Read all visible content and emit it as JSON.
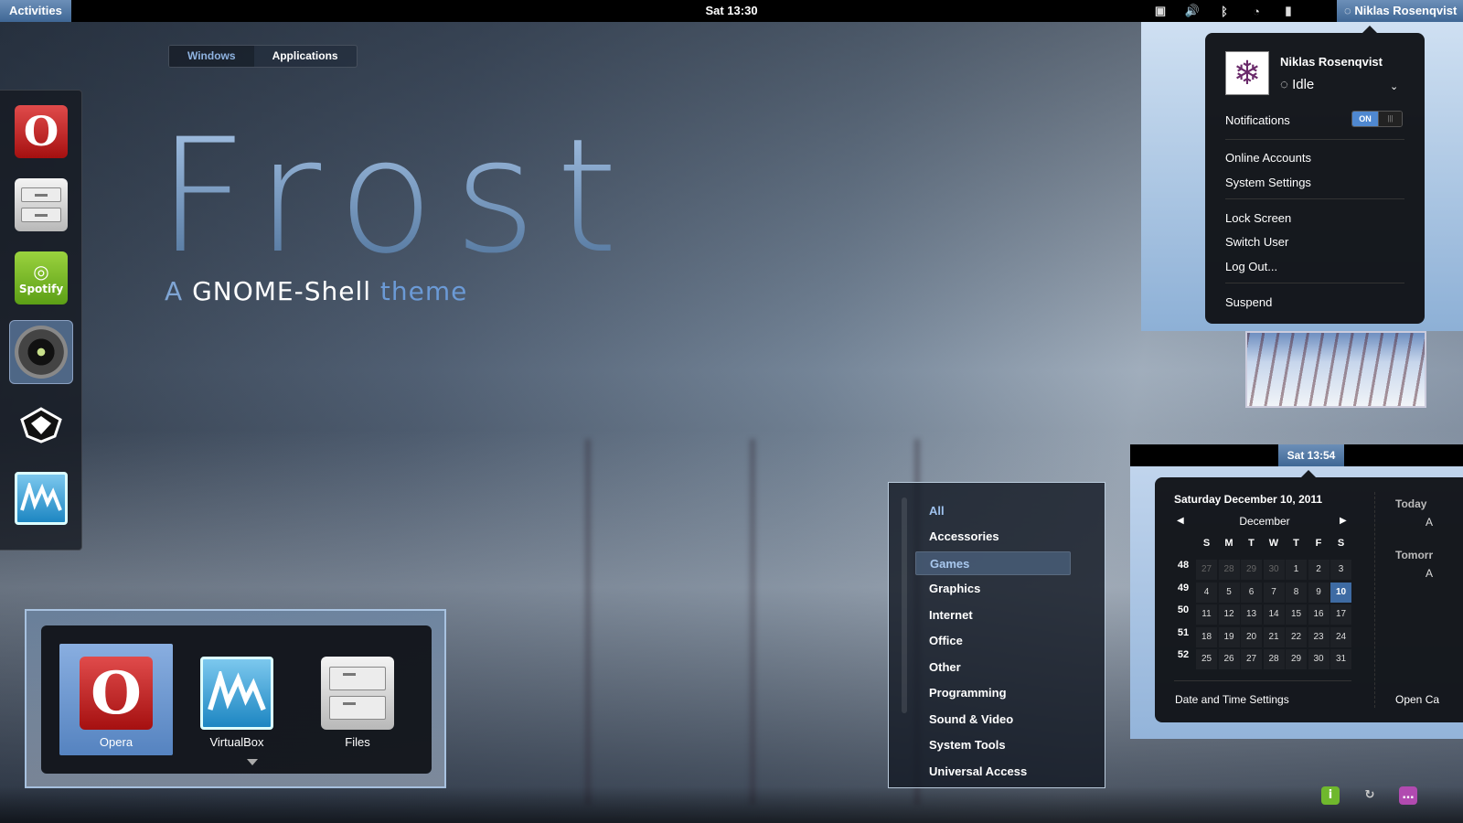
{
  "topbar": {
    "activities": "Activities",
    "clock": "Sat 13:30",
    "user_name": "Niklas Rosenqvist",
    "tray_icons": [
      "display-icon",
      "volume-icon",
      "bluetooth-icon",
      "wifi-icon",
      "battery-icon"
    ]
  },
  "view_selector": {
    "windows": "Windows",
    "applications": "Applications"
  },
  "dash": {
    "items": [
      {
        "name": "opera-icon",
        "selected": false
      },
      {
        "name": "files-icon",
        "selected": false
      },
      {
        "name": "spotify-icon",
        "label": "Spotify",
        "selected": false
      },
      {
        "name": "camera-icon",
        "selected": true
      },
      {
        "name": "inkscape-icon",
        "selected": false
      },
      {
        "name": "virtualbox-icon",
        "selected": false
      }
    ]
  },
  "hero": {
    "title": "Frost",
    "sub_a": "A",
    "sub_b": "GNOME-Shell",
    "sub_c": "theme"
  },
  "switcher": {
    "items": [
      {
        "label": "Opera",
        "selected": true
      },
      {
        "label": "VirtualBox",
        "selected": false
      },
      {
        "label": "Files",
        "selected": false
      }
    ]
  },
  "categories": {
    "items": [
      "All",
      "Accessories",
      "Games",
      "Graphics",
      "Internet",
      "Office",
      "Other",
      "Programming",
      "Sound & Video",
      "System Tools",
      "Universal Access"
    ],
    "selected": "Games"
  },
  "user_menu": {
    "name": "Niklas Rosenqvist",
    "status": "Idle",
    "notifications_label": "Notifications",
    "toggle_on": "ON",
    "items1": [
      "Online Accounts",
      "System Settings"
    ],
    "items2": [
      "Lock Screen",
      "Switch User",
      "Log Out..."
    ],
    "items3": [
      "Suspend"
    ]
  },
  "calendar": {
    "time": "Sat 13:54",
    "date_heading": "Saturday December 10, 2011",
    "month": "December",
    "dow": [
      "S",
      "M",
      "T",
      "W",
      "T",
      "F",
      "S"
    ],
    "weeks": [
      "48",
      "49",
      "50",
      "51",
      "52"
    ],
    "rows": [
      [
        "27",
        "28",
        "29",
        "30",
        "1",
        "2",
        "3"
      ],
      [
        "4",
        "5",
        "6",
        "7",
        "8",
        "9",
        "10"
      ],
      [
        "11",
        "12",
        "13",
        "14",
        "15",
        "16",
        "17"
      ],
      [
        "18",
        "19",
        "20",
        "21",
        "22",
        "23",
        "24"
      ],
      [
        "25",
        "26",
        "27",
        "28",
        "29",
        "30",
        "31"
      ]
    ],
    "today": "10",
    "settings_label": "Date and Time Settings",
    "side_today": "Today",
    "side_tomorrow": "Tomorr",
    "side_a1": "A",
    "side_a2": "A",
    "open_label": "Open Ca"
  },
  "bottom_tray": [
    "info-icon",
    "refresh-icon",
    "chat-icon"
  ],
  "colors": {
    "accent": "#4f88d0",
    "selected_blue": "#5583c0",
    "panel": "#101216"
  }
}
